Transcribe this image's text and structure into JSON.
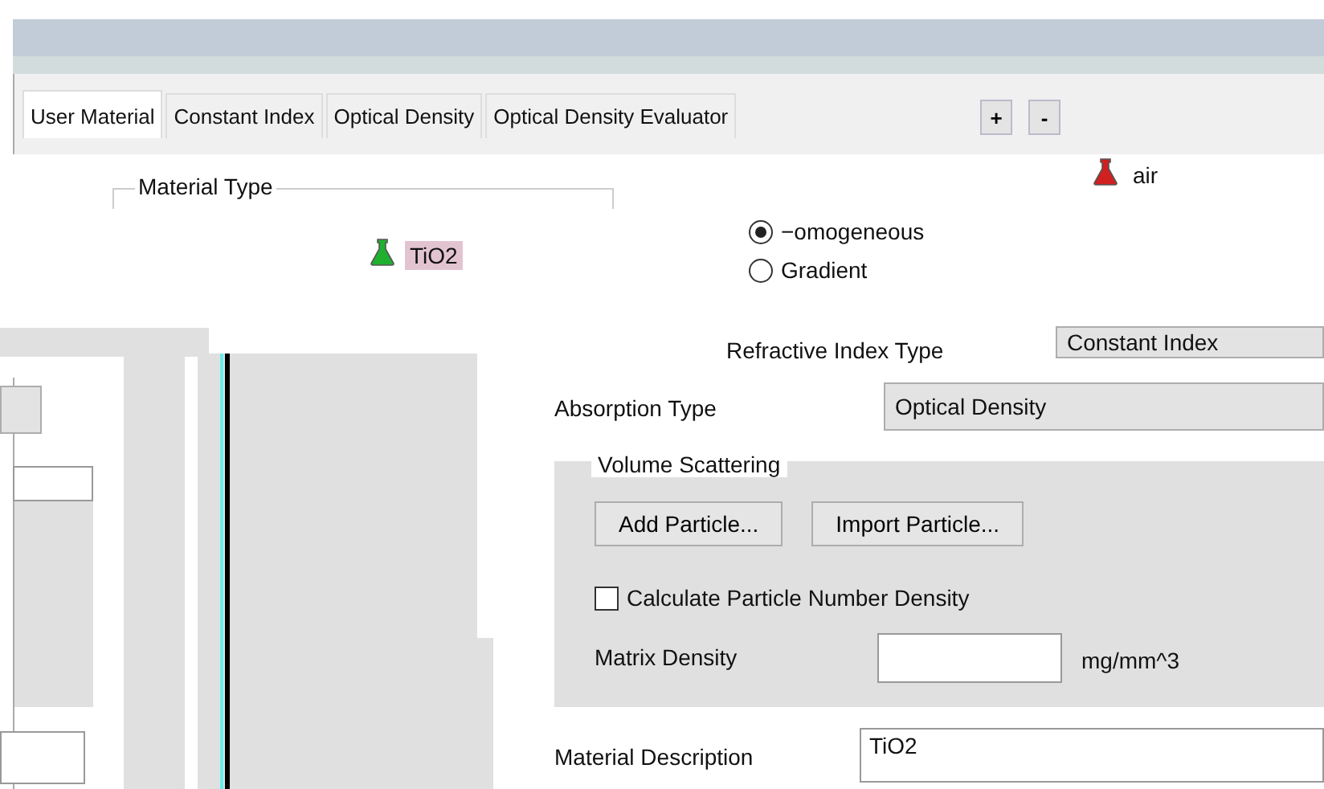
{
  "tabs": [
    {
      "label": "User Material",
      "selected": true
    },
    {
      "label": "Constant Index",
      "selected": false
    },
    {
      "label": "Optical Density",
      "selected": false
    },
    {
      "label": "Optical Density Evaluator",
      "selected": false
    }
  ],
  "tree_buttons": [
    "+",
    "-"
  ],
  "tree": [
    {
      "label": "air",
      "color": "#d02020",
      "selected": false
    },
    {
      "label": "TiO2",
      "color": "#20b030",
      "selected": true
    }
  ],
  "material_type": {
    "title": "Material Type",
    "options": [
      {
        "label": "−omogeneous",
        "selected": true
      },
      {
        "label": "Gradient",
        "selected": false
      }
    ]
  },
  "refractive_index_type": {
    "label": "Refractive Index Type",
    "value": "Constant Index"
  },
  "absorption_type": {
    "label": "Absorption Type",
    "value": "Optical Density"
  },
  "volume_scattering": {
    "title": "Volume Scattering",
    "buttons": [
      "Add Particle...",
      "Import Particle..."
    ],
    "calculate_density": {
      "label": "Calculate Particle Number Density",
      "checked": false
    },
    "matrix_density": {
      "label": "Matrix Density",
      "unit": "mg/mm^3"
    }
  },
  "material_description": {
    "label": "Material Description",
    "value": "TiO2"
  }
}
